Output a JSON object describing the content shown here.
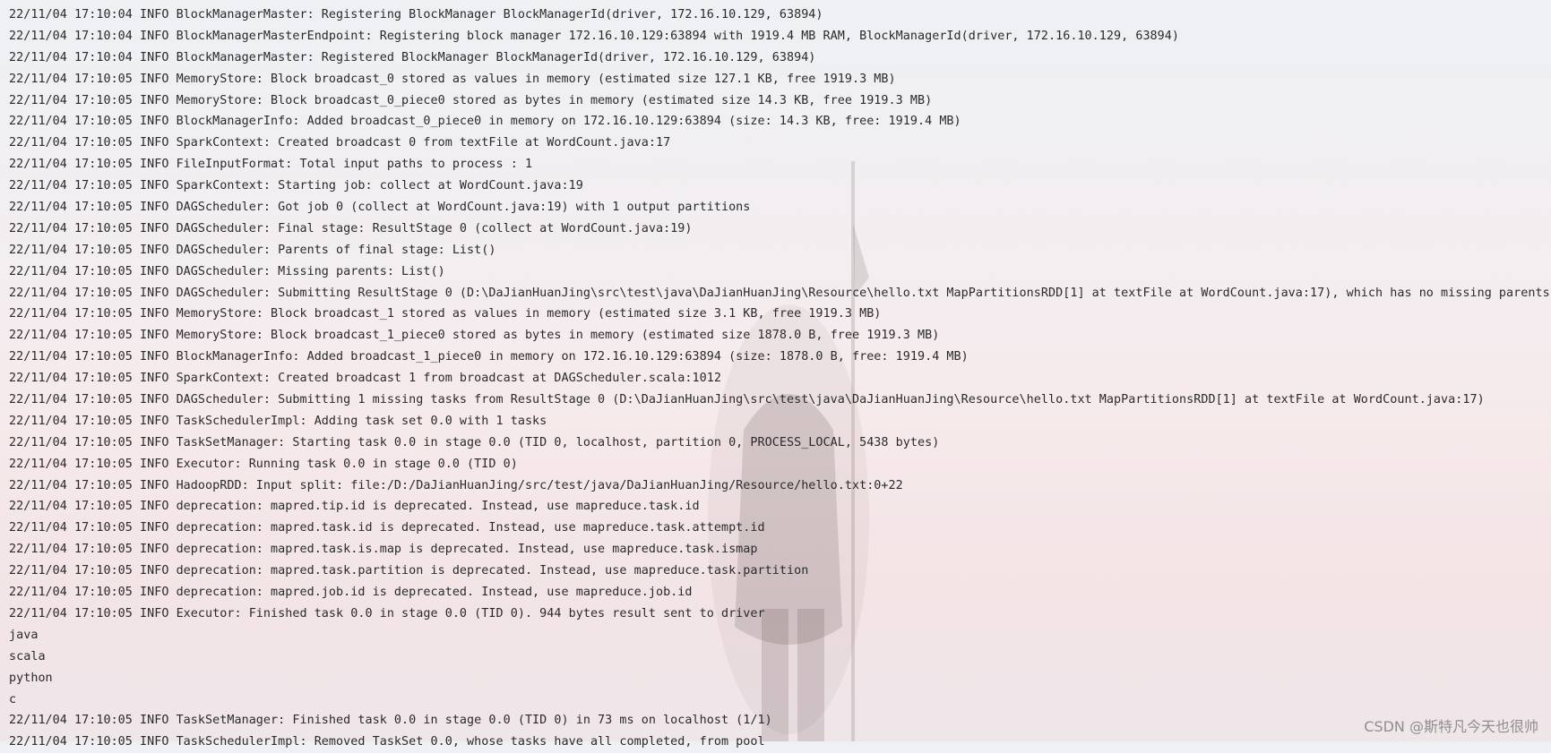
{
  "console": {
    "lines": [
      "22/11/04 17:10:04 INFO BlockManagerMaster: Registering BlockManager BlockManagerId(driver, 172.16.10.129, 63894)",
      "22/11/04 17:10:04 INFO BlockManagerMasterEndpoint: Registering block manager 172.16.10.129:63894 with 1919.4 MB RAM, BlockManagerId(driver, 172.16.10.129, 63894)",
      "22/11/04 17:10:04 INFO BlockManagerMaster: Registered BlockManager BlockManagerId(driver, 172.16.10.129, 63894)",
      "22/11/04 17:10:05 INFO MemoryStore: Block broadcast_0 stored as values in memory (estimated size 127.1 KB, free 1919.3 MB)",
      "22/11/04 17:10:05 INFO MemoryStore: Block broadcast_0_piece0 stored as bytes in memory (estimated size 14.3 KB, free 1919.3 MB)",
      "22/11/04 17:10:05 INFO BlockManagerInfo: Added broadcast_0_piece0 in memory on 172.16.10.129:63894 (size: 14.3 KB, free: 1919.4 MB)",
      "22/11/04 17:10:05 INFO SparkContext: Created broadcast 0 from textFile at WordCount.java:17",
      "22/11/04 17:10:05 INFO FileInputFormat: Total input paths to process : 1",
      "22/11/04 17:10:05 INFO SparkContext: Starting job: collect at WordCount.java:19",
      "22/11/04 17:10:05 INFO DAGScheduler: Got job 0 (collect at WordCount.java:19) with 1 output partitions",
      "22/11/04 17:10:05 INFO DAGScheduler: Final stage: ResultStage 0 (collect at WordCount.java:19)",
      "22/11/04 17:10:05 INFO DAGScheduler: Parents of final stage: List()",
      "22/11/04 17:10:05 INFO DAGScheduler: Missing parents: List()",
      "22/11/04 17:10:05 INFO DAGScheduler: Submitting ResultStage 0 (D:\\DaJianHuanJing\\src\\test\\java\\DaJianHuanJing\\Resource\\hello.txt MapPartitionsRDD[1] at textFile at WordCount.java:17), which has no missing parents",
      "22/11/04 17:10:05 INFO MemoryStore: Block broadcast_1 stored as values in memory (estimated size 3.1 KB, free 1919.3 MB)",
      "22/11/04 17:10:05 INFO MemoryStore: Block broadcast_1_piece0 stored as bytes in memory (estimated size 1878.0 B, free 1919.3 MB)",
      "22/11/04 17:10:05 INFO BlockManagerInfo: Added broadcast_1_piece0 in memory on 172.16.10.129:63894 (size: 1878.0 B, free: 1919.4 MB)",
      "22/11/04 17:10:05 INFO SparkContext: Created broadcast 1 from broadcast at DAGScheduler.scala:1012",
      "22/11/04 17:10:05 INFO DAGScheduler: Submitting 1 missing tasks from ResultStage 0 (D:\\DaJianHuanJing\\src\\test\\java\\DaJianHuanJing\\Resource\\hello.txt MapPartitionsRDD[1] at textFile at WordCount.java:17)",
      "22/11/04 17:10:05 INFO TaskSchedulerImpl: Adding task set 0.0 with 1 tasks",
      "22/11/04 17:10:05 INFO TaskSetManager: Starting task 0.0 in stage 0.0 (TID 0, localhost, partition 0, PROCESS_LOCAL, 5438 bytes)",
      "22/11/04 17:10:05 INFO Executor: Running task 0.0 in stage 0.0 (TID 0)",
      "22/11/04 17:10:05 INFO HadoopRDD: Input split: file:/D:/DaJianHuanJing/src/test/java/DaJianHuanJing/Resource/hello.txt:0+22",
      "22/11/04 17:10:05 INFO deprecation: mapred.tip.id is deprecated. Instead, use mapreduce.task.id",
      "22/11/04 17:10:05 INFO deprecation: mapred.task.id is deprecated. Instead, use mapreduce.task.attempt.id",
      "22/11/04 17:10:05 INFO deprecation: mapred.task.is.map is deprecated. Instead, use mapreduce.task.ismap",
      "22/11/04 17:10:05 INFO deprecation: mapred.task.partition is deprecated. Instead, use mapreduce.task.partition",
      "22/11/04 17:10:05 INFO deprecation: mapred.job.id is deprecated. Instead, use mapreduce.job.id",
      "22/11/04 17:10:05 INFO Executor: Finished task 0.0 in stage 0.0 (TID 0). 944 bytes result sent to driver",
      "java",
      "scala",
      "python",
      "c",
      "22/11/04 17:10:05 INFO TaskSetManager: Finished task 0.0 in stage 0.0 (TID 0) in 73 ms on localhost (1/1)",
      "22/11/04 17:10:05 INFO TaskSchedulerImpl: Removed TaskSet 0.0, whose tasks have all completed, from pool"
    ]
  },
  "watermark": "CSDN @斯特凡今天也很帅"
}
